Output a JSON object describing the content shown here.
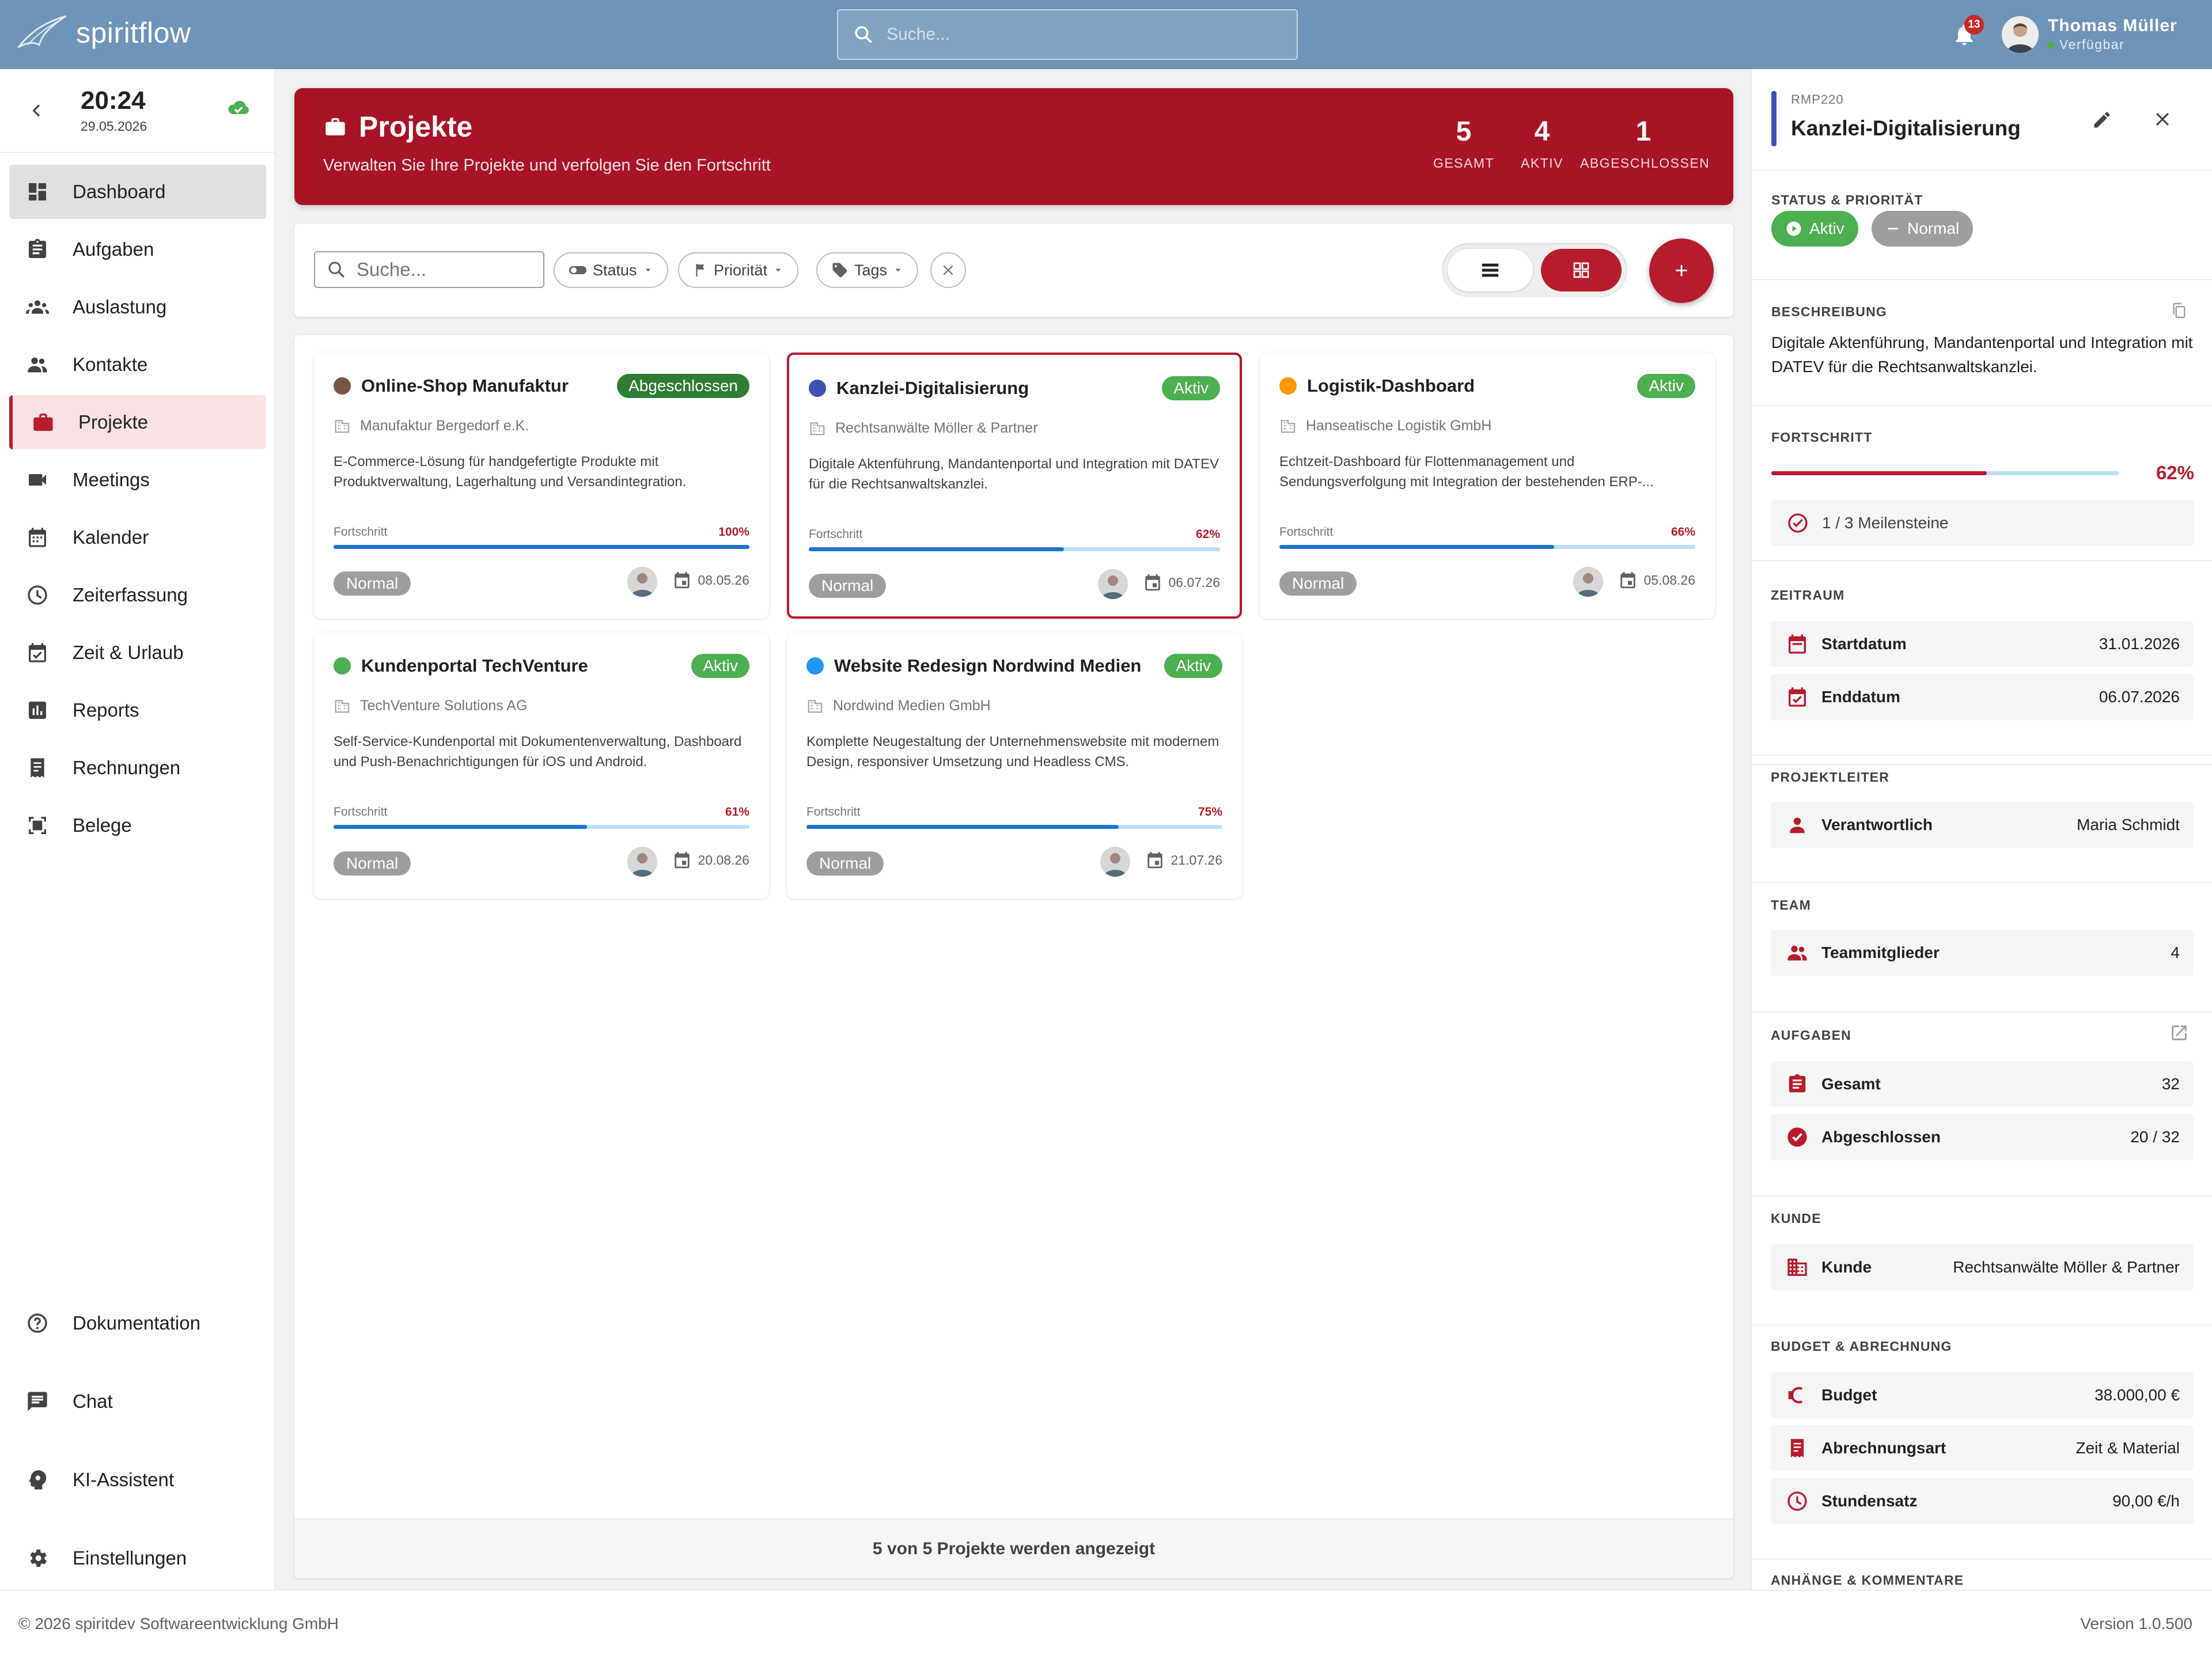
{
  "app": {
    "name": "spiritflow"
  },
  "topbar": {
    "search_placeholder": "Suche...",
    "notifications": "13",
    "user_name": "Thomas Müller",
    "user_status": "Verfügbar"
  },
  "sidebar": {
    "time": "20:24",
    "date": "29.05.2026",
    "items": [
      {
        "label": "Dashboard",
        "icon": "dashboard-icon"
      },
      {
        "label": "Aufgaben",
        "icon": "clipboard-icon"
      },
      {
        "label": "Auslastung",
        "icon": "group-icon"
      },
      {
        "label": "Kontakte",
        "icon": "people-icon"
      },
      {
        "label": "Projekte",
        "icon": "briefcase-icon"
      },
      {
        "label": "Meetings",
        "icon": "video-icon"
      },
      {
        "label": "Kalender",
        "icon": "calendar-icon"
      },
      {
        "label": "Zeiterfassung",
        "icon": "clock-icon"
      },
      {
        "label": "Zeit & Urlaub",
        "icon": "calendar-check-icon"
      },
      {
        "label": "Reports",
        "icon": "bar-chart-icon"
      },
      {
        "label": "Rechnungen",
        "icon": "receipt-icon"
      },
      {
        "label": "Belege",
        "icon": "document-scan-icon"
      }
    ],
    "bottom_items": [
      {
        "label": "Dokumentation",
        "icon": "help-icon"
      },
      {
        "label": "Chat",
        "icon": "chat-icon"
      },
      {
        "label": "KI-Assistent",
        "icon": "ai-head-icon"
      },
      {
        "label": "Einstellungen",
        "icon": "gear-icon"
      }
    ]
  },
  "banner": {
    "title": "Projekte",
    "subtitle": "Verwalten Sie Ihre Projekte und verfolgen Sie den Fortschritt",
    "stats": [
      {
        "value": "5",
        "label": "GESAMT"
      },
      {
        "value": "4",
        "label": "AKTIV"
      },
      {
        "value": "1",
        "label": "ABGESCHLOSSEN"
      }
    ]
  },
  "toolbar": {
    "search_placeholder": "Suche...",
    "filter_status": "Status",
    "filter_priority": "Priorität",
    "filter_tags": "Tags",
    "add_label": "+"
  },
  "cards": [
    {
      "title": "Online-Shop Manufaktur",
      "color": "#795548",
      "status": "Abgeschlossen",
      "client": "Manufaktur Bergedorf e.K.",
      "description": "E-Commerce-Lösung für handgefertigte Produkte mit Produktverwaltung, Lagerhaltung und Versandintegration.",
      "progress_label": "Fortschritt",
      "progress_text": "100%",
      "progress": 100,
      "priority": "Normal",
      "date": "08.05.26"
    },
    {
      "title": "Kanzlei-Digitalisierung",
      "color": "#3f51b5",
      "status": "Aktiv",
      "client": "Rechtsanwälte Möller & Partner",
      "description": "Digitale Aktenführung, Mandantenportal und Integration mit DATEV für die Rechtsanwaltskanzlei.",
      "progress_label": "Fortschritt",
      "progress_text": "62%",
      "progress": 62,
      "priority": "Normal",
      "date": "06.07.26"
    },
    {
      "title": "Logistik-Dashboard",
      "color": "#ff9800",
      "status": "Aktiv",
      "client": "Hanseatische Logistik GmbH",
      "description": "Echtzeit-Dashboard für Flottenmanagement und Sendungsverfolgung mit Integration der bestehenden ERP-...",
      "progress_label": "Fortschritt",
      "progress_text": "66%",
      "progress": 66,
      "priority": "Normal",
      "date": "05.08.26"
    },
    {
      "title": "Kundenportal TechVenture",
      "color": "#4caf50",
      "status": "Aktiv",
      "client": "TechVenture Solutions AG",
      "description": "Self-Service-Kundenportal mit Dokumentenverwaltung, Dashboard und Push-Benachrichtigungen für iOS und Android.",
      "progress_label": "Fortschritt",
      "progress_text": "61%",
      "progress": 61,
      "priority": "Normal",
      "date": "20.08.26"
    },
    {
      "title": "Website Redesign Nordwind Medien",
      "color": "#2196f3",
      "status": "Aktiv",
      "client": "Nordwind Medien GmbH",
      "description": "Komplette Neugestaltung der Unternehmenswebsite mit modernem Design, responsiver Umsetzung und Headless CMS.",
      "progress_label": "Fortschritt",
      "progress_text": "75%",
      "progress": 75,
      "priority": "Normal",
      "date": "21.07.26"
    }
  ],
  "list_footer": "5 von 5 Projekte werden angezeigt",
  "detail": {
    "code": "RMP220",
    "title": "Kanzlei-Digitalisierung",
    "status_title": "STATUS & PRIORITÄT",
    "status": "Aktiv",
    "priority": "Normal",
    "desc_title": "BESCHREIBUNG",
    "description": "Digitale Aktenführung, Mandantenportal und Integration mit DATEV für die Rechtsanwaltskanzlei.",
    "progress_title": "FORTSCHRITT",
    "progress_text": "62%",
    "progress": 62,
    "milestones": "1 / 3 Meilensteine",
    "period_title": "ZEITRAUM",
    "start_label": "Startdatum",
    "start": "31.01.2026",
    "end_label": "Enddatum",
    "end": "06.07.2026",
    "lead_title": "PROJEKTLEITER",
    "lead_label": "Verantwortlich",
    "lead": "Maria Schmidt",
    "team_title": "TEAM",
    "team_label": "Teammitglieder",
    "team": "4",
    "tasks_title": "AUFGABEN",
    "tasks_total_label": "Gesamt",
    "tasks_total": "32",
    "tasks_done_label": "Abgeschlossen",
    "tasks_done": "20 / 32",
    "client_title": "KUNDE",
    "client_label": "Kunde",
    "client": "Rechtsanwälte Möller & Partner",
    "budget_title": "BUDGET & ABRECHNUNG",
    "budget_label": "Budget",
    "budget": "38.000,00 €",
    "billing_label": "Abrechnungsart",
    "billing": "Zeit & Material",
    "rate_label": "Stundensatz",
    "rate": "90,00 €/h",
    "attachments_title": "ANHÄNGE & KOMMENTARE"
  },
  "footer": {
    "copyright": "© 2026 spiritdev Softwareentwicklung GmbH",
    "version": "Version 1.0.500"
  },
  "colors": {
    "brand": "#b71c2c",
    "topbar": "#6e94b8",
    "progress": "#1976d2",
    "active": "#4caf50",
    "done": "#2e7d32"
  }
}
